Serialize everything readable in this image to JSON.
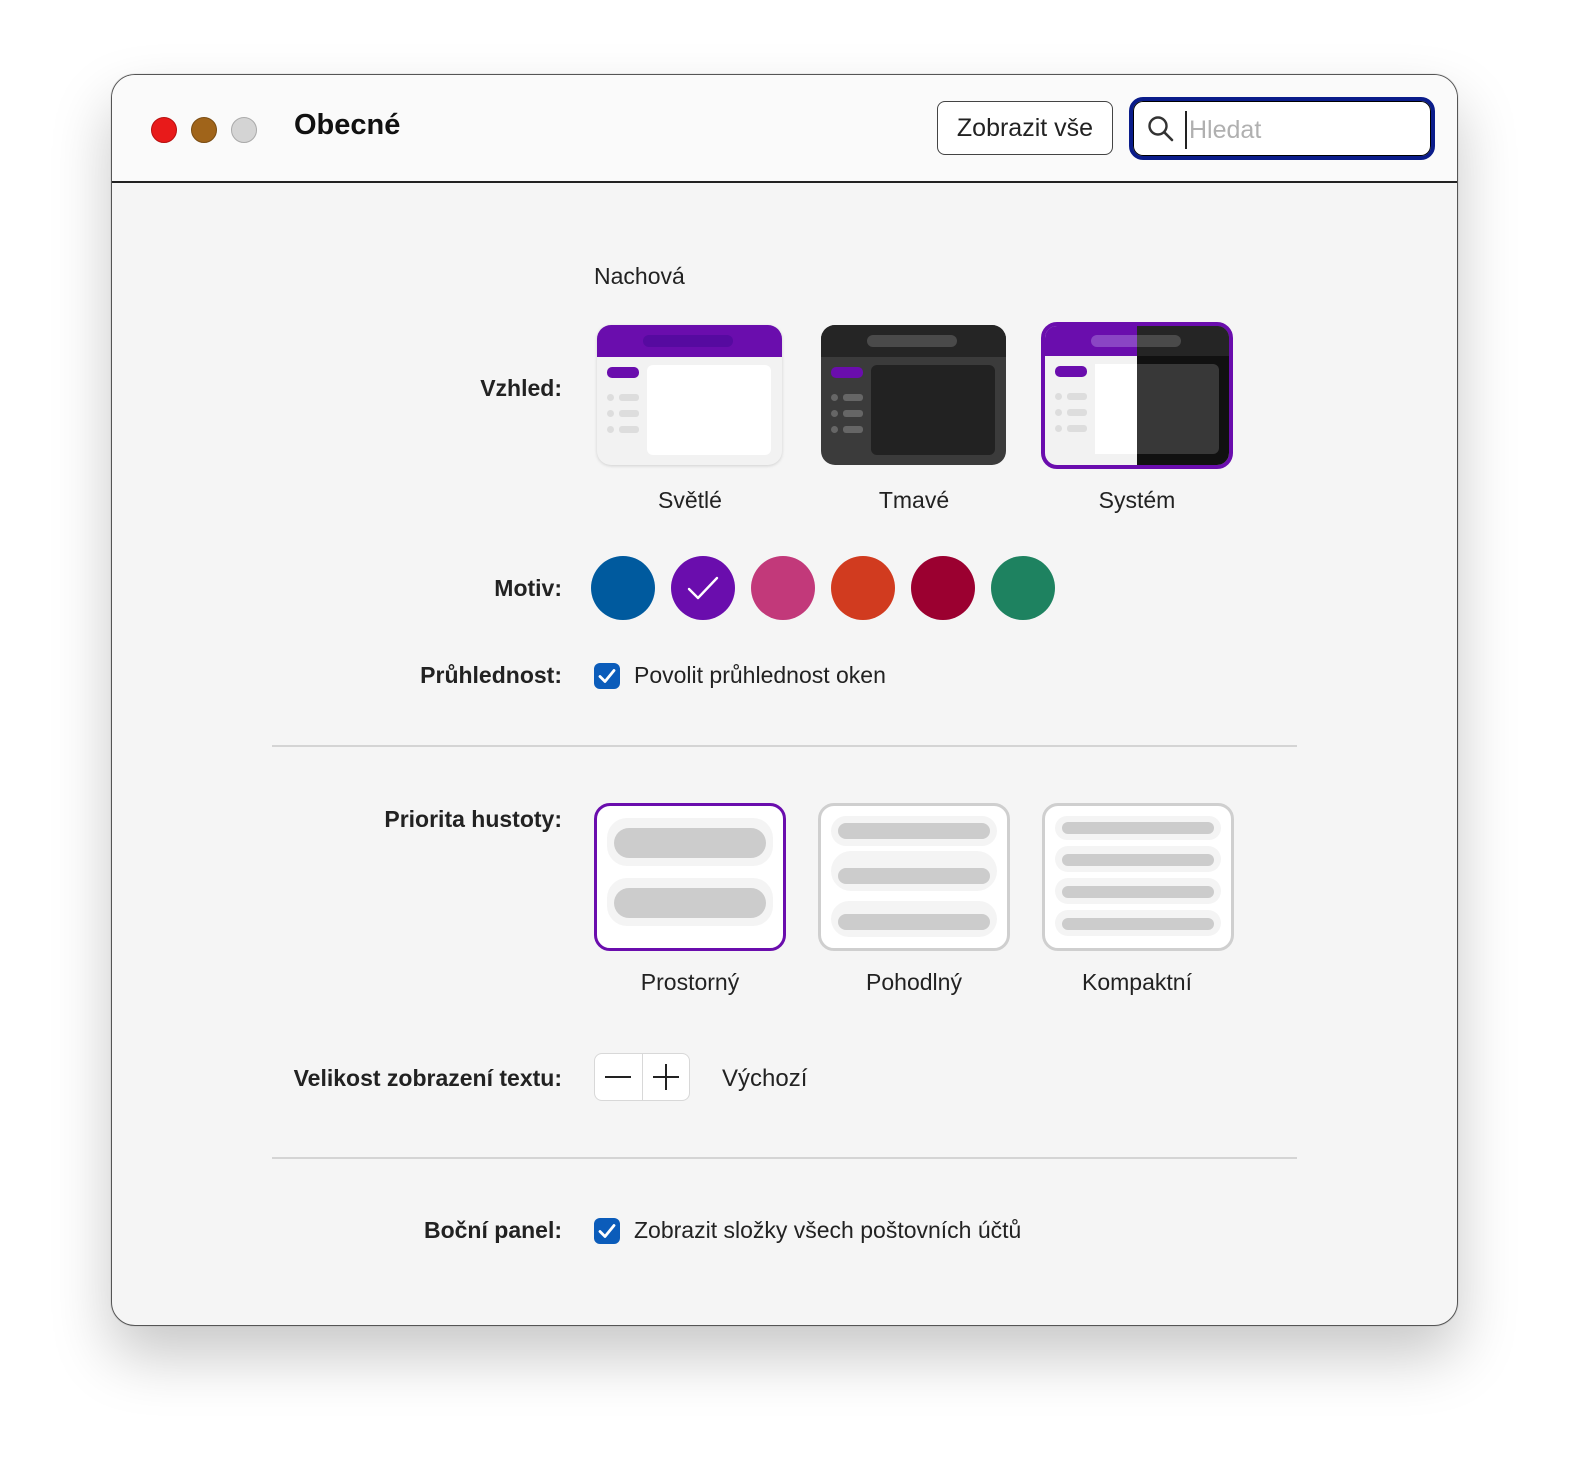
{
  "window": {
    "title": "Obecné",
    "show_all_label": "Zobrazit vše",
    "search_placeholder": "Hledat"
  },
  "appearance": {
    "accent_name": "Nachová",
    "label": "Vzhled:",
    "options": [
      {
        "label": "Světlé",
        "selected": false
      },
      {
        "label": "Tmavé",
        "selected": false
      },
      {
        "label": "Systém",
        "selected": true
      }
    ]
  },
  "theme": {
    "label": "Motiv:",
    "colors": [
      {
        "name": "blue",
        "hex": "#005a9e",
        "selected": false
      },
      {
        "name": "purple",
        "hex": "#6a0dad",
        "selected": true
      },
      {
        "name": "pink",
        "hex": "#c2397a",
        "selected": false
      },
      {
        "name": "orange",
        "hex": "#d13b1f",
        "selected": false
      },
      {
        "name": "red",
        "hex": "#9b0030",
        "selected": false
      },
      {
        "name": "green",
        "hex": "#1e8260",
        "selected": false
      }
    ]
  },
  "transparency": {
    "label": "Průhlednost:",
    "checkbox_label": "Povolit průhlednost oken",
    "checked": true
  },
  "density": {
    "label": "Priorita hustoty:",
    "options": [
      {
        "label": "Prostorný",
        "selected": true
      },
      {
        "label": "Pohodlný",
        "selected": false
      },
      {
        "label": "Kompaktní",
        "selected": false
      }
    ]
  },
  "text_size": {
    "label": "Velikost zobrazení textu:",
    "value": "Výchozí"
  },
  "sidebar": {
    "label": "Boční panel:",
    "checkbox_label": "Zobrazit složky všech poštovních účtů",
    "checked": true
  },
  "colors": {
    "accent": "#6a0dad",
    "checkbox": "#0b5cba",
    "focus_ring": "#0a1c8a"
  }
}
